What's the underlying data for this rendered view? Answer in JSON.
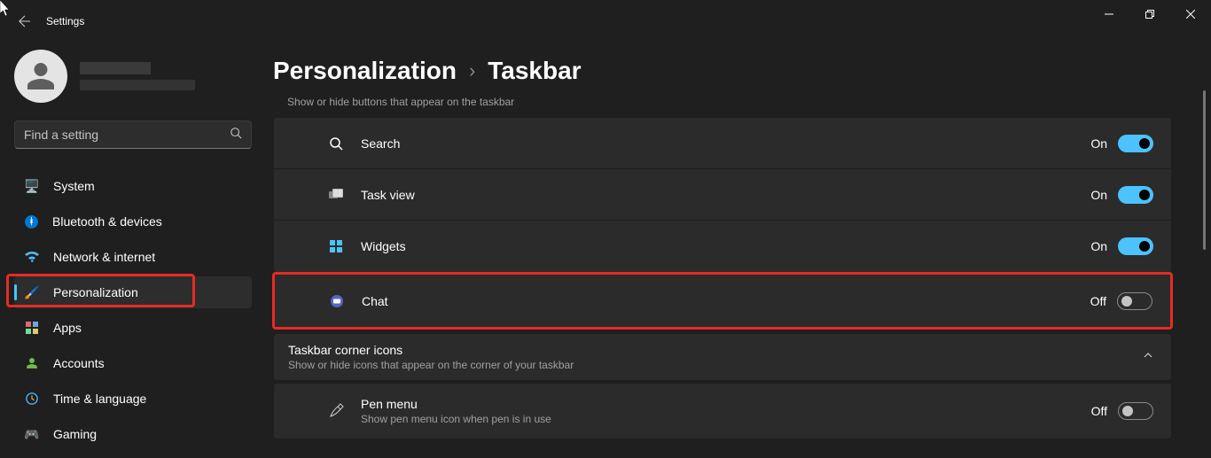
{
  "window": {
    "title": "Settings"
  },
  "search": {
    "placeholder": "Find a setting"
  },
  "sidebar": {
    "items": [
      {
        "label": "System",
        "icon_emoji": "🖥️"
      },
      {
        "label": "Bluetooth & devices",
        "icon_emoji": "ᛒ"
      },
      {
        "label": "Network & internet",
        "icon_emoji": "📶"
      },
      {
        "label": "Personalization",
        "icon_emoji": "🖌️"
      },
      {
        "label": "Apps",
        "icon_emoji": "▦"
      },
      {
        "label": "Accounts",
        "icon_emoji": "👤"
      },
      {
        "label": "Time & language",
        "icon_emoji": "🕑"
      },
      {
        "label": "Gaming",
        "icon_emoji": "🎮"
      }
    ]
  },
  "breadcrumb": {
    "parent": "Personalization",
    "sep": "›",
    "current": "Taskbar"
  },
  "taskbar_items": {
    "subtitle": "Show or hide buttons that appear on the taskbar",
    "rows": [
      {
        "label": "Search",
        "state": "On"
      },
      {
        "label": "Task view",
        "state": "On"
      },
      {
        "label": "Widgets",
        "state": "On"
      },
      {
        "label": "Chat",
        "state": "Off"
      }
    ]
  },
  "corner_icons": {
    "title": "Taskbar corner icons",
    "subtitle": "Show or hide icons that appear on the corner of your taskbar",
    "rows": [
      {
        "label": "Pen menu",
        "sub": "Show pen menu icon when pen is in use",
        "state": "Off"
      }
    ]
  }
}
